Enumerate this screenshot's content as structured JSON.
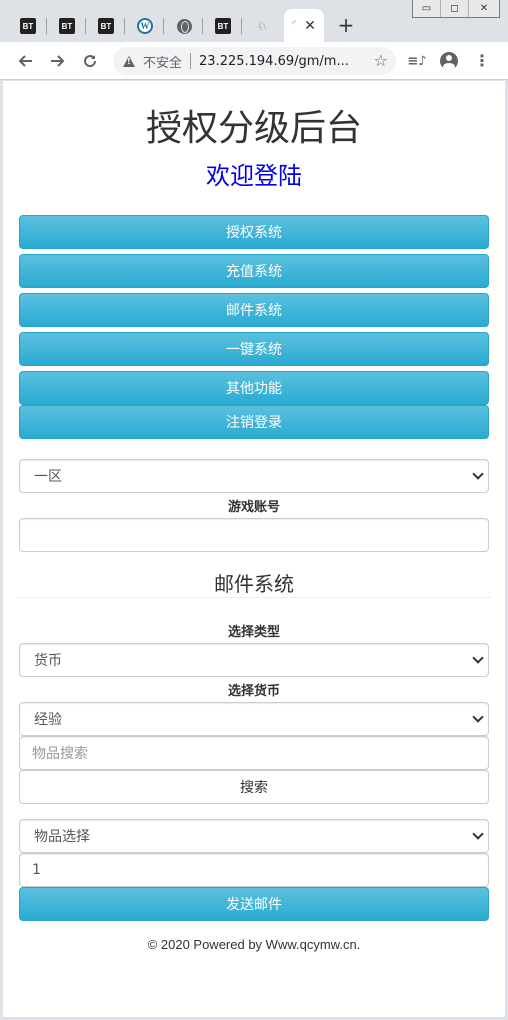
{
  "browser": {
    "tabs": [
      {
        "icon": "bt-icon",
        "label": "BT"
      },
      {
        "icon": "bt-icon",
        "label": "BT"
      },
      {
        "icon": "bt-icon",
        "label": "BT"
      },
      {
        "icon": "wordpress-icon",
        "label": "W"
      },
      {
        "icon": "globe-icon",
        "label": ""
      },
      {
        "icon": "bt-icon",
        "label": "BT"
      },
      {
        "icon": "site-favicon",
        "label": ""
      }
    ],
    "active_tab_close": "✕",
    "new_tab": "+",
    "security_label": "不安全",
    "url": "23.225.194.69/gm/m...",
    "window_controls": {
      "minimize": "▭",
      "maximize": "◻",
      "close": "✕"
    }
  },
  "page": {
    "title": "授权分级后台",
    "welcome": "欢迎登陆",
    "menu": [
      "授权系统",
      "充值系统",
      "邮件系统",
      "一键系统",
      "其他功能",
      "注销登录"
    ],
    "server_select": "一区",
    "account_label": "游戏账号",
    "account_value": "",
    "section_title": "邮件系统",
    "type_label": "选择类型",
    "type_select": "货币",
    "currency_label": "选择货币",
    "currency_select": "经验",
    "search_placeholder": "物品搜索",
    "search_button": "搜索",
    "item_select": "物品选择",
    "quantity_value": "1",
    "send_button": "发送邮件",
    "footer": "© 2020 Powered by Www.qcymw.cn."
  },
  "colors": {
    "primary_button": "#5bc0de",
    "welcome_link": "#0000ee"
  }
}
